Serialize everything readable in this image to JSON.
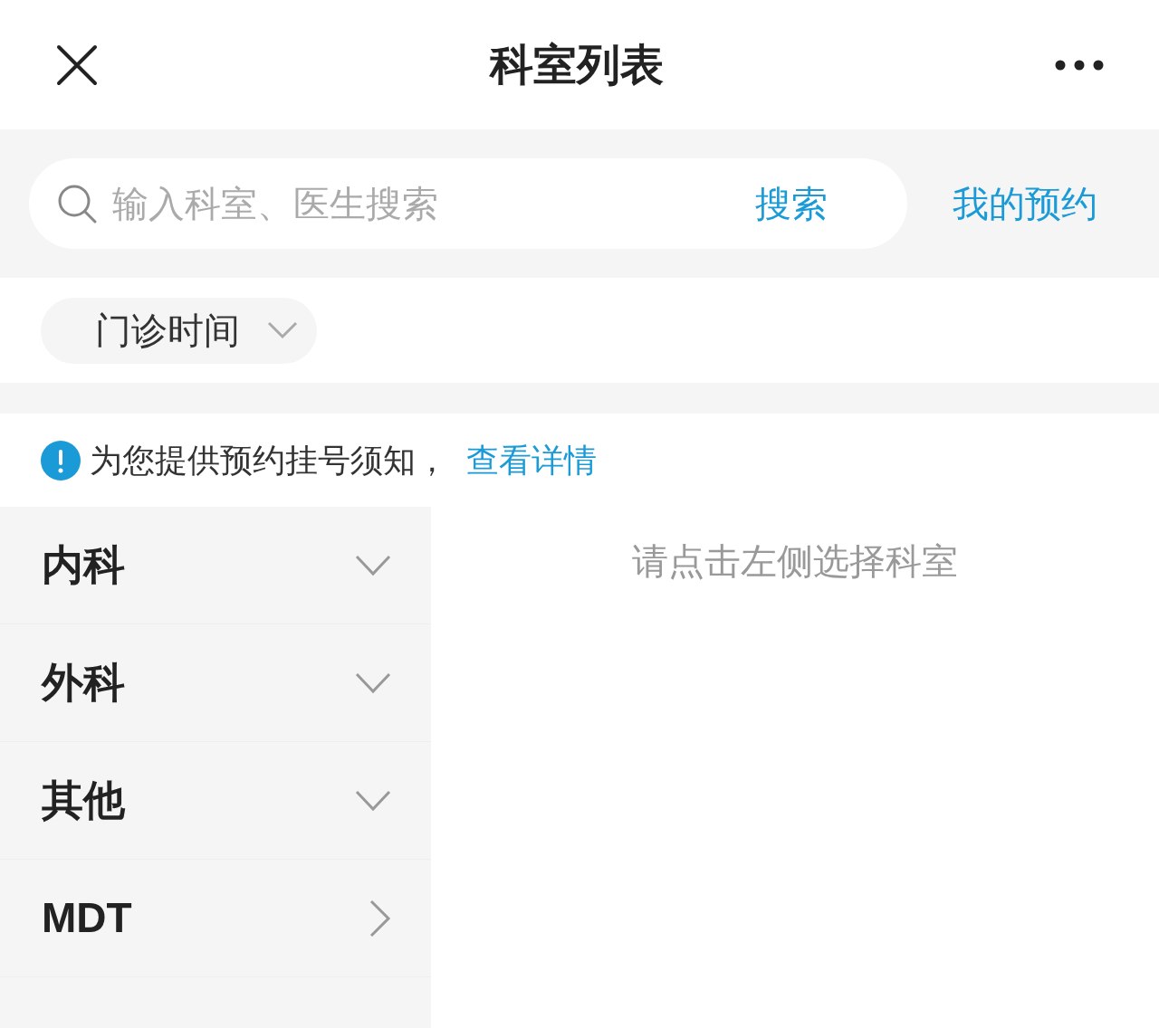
{
  "header": {
    "title": "科室列表"
  },
  "search": {
    "placeholder": "输入科室、医生搜索",
    "button": "搜索",
    "link": "我的预约"
  },
  "filter": {
    "label": "门诊时间"
  },
  "notice": {
    "text": "为您提供预约挂号须知，",
    "link": "查看详情"
  },
  "departments": [
    {
      "label": "内科",
      "kind": "group"
    },
    {
      "label": "外科",
      "kind": "group"
    },
    {
      "label": "其他",
      "kind": "group"
    },
    {
      "label": "MDT",
      "kind": "link"
    }
  ],
  "content": {
    "hint": "请点击左侧选择科室"
  }
}
